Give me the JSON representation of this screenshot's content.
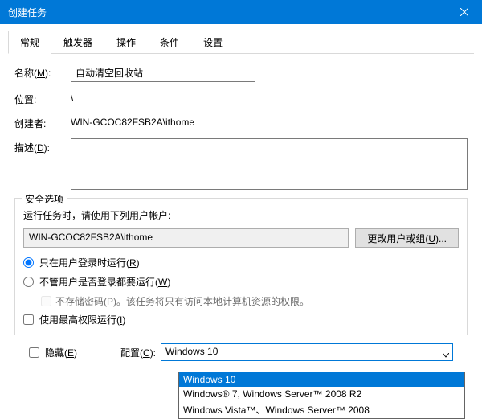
{
  "title": "创建任务",
  "tabs": [
    "常规",
    "触发器",
    "操作",
    "条件",
    "设置"
  ],
  "labels": {
    "name": "名称(M):",
    "location": "位置:",
    "creator": "创建者:",
    "description": "描述(D):"
  },
  "name_value": "自动清空回收站",
  "location_value": "\\",
  "creator_value": "WIN-GCOC82FSB2A\\ithome",
  "security": {
    "legend": "安全选项",
    "prompt": "运行任务时，请使用下列用户帐户:",
    "user": "WIN-GCOC82FSB2A\\ithome",
    "change_btn": "更改用户或组(U)...",
    "radio1": "只在用户登录时运行(R)",
    "radio2": "不管用户是否登录都要运行(W)",
    "nopwd": "不存储密码(P)。该任务将只有访问本地计算机资源的权限。",
    "highest": "使用最高权限运行(I)"
  },
  "hidden_label": "隐藏(E)",
  "config_label": "配置(C):",
  "config_value": "Windows 10",
  "config_options": [
    "Windows 10",
    "Windows® 7, Windows Server™ 2008 R2",
    "Windows Vista™、Windows Server™ 2008"
  ]
}
